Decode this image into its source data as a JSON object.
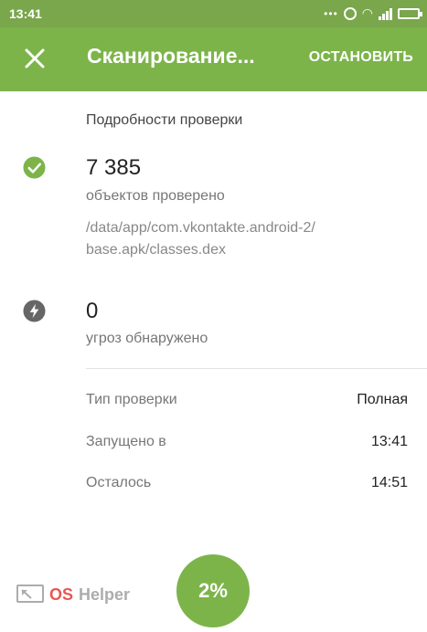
{
  "status_bar": {
    "time": "13:41",
    "dots": "•••",
    "wifi_glyph": "◠"
  },
  "app_bar": {
    "close_icon": "close-icon",
    "title": "Сканирование...",
    "stop_label": "ОСТАНОВИТЬ",
    "color": "#7cb44a"
  },
  "details": {
    "section_title": "Подробности проверки",
    "scanned": {
      "icon": "check-circle-icon",
      "count": "7 385",
      "label": "объектов проверено",
      "path_line1": "/data/app/com.vkontakte.android-2/",
      "path_line2": "base.apk/classes.dex"
    },
    "threats": {
      "icon": "lightning-icon",
      "count": "0",
      "label": "угроз обнаружено"
    }
  },
  "info": {
    "scan_type_key": "Тип проверки",
    "scan_type_value": "Полная",
    "started_key": "Запущено в",
    "started_value": "13:41",
    "remaining_key": "Осталось",
    "remaining_value": "14:51"
  },
  "progress": {
    "label": "2%",
    "value": 0.02
  },
  "watermark": {
    "os": "OS",
    "helper": "Helper"
  }
}
